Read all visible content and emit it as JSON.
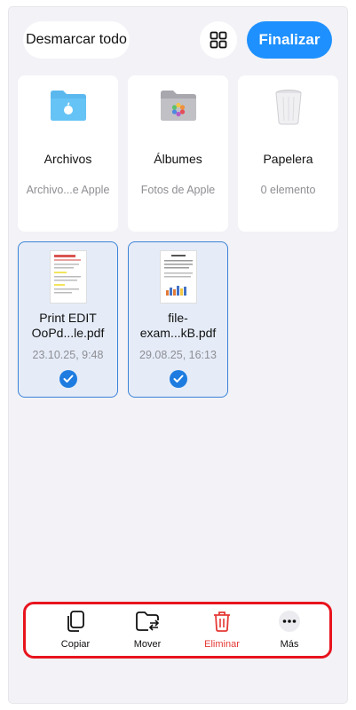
{
  "header": {
    "deselect_label": "Desmarcar todo",
    "finish_label": "Finalizar"
  },
  "locations": [
    {
      "name": "Archivos",
      "sub": "Archivo...e Apple",
      "icon": "folder-icon"
    },
    {
      "name": "Álbumes",
      "sub": "Fotos de Apple",
      "icon": "photos-folder-icon"
    },
    {
      "name": "Papelera",
      "sub": "0 elemento",
      "icon": "trash-can-icon"
    }
  ],
  "files": [
    {
      "name": "Print EDIT OoPd...le.pdf",
      "date": "23.10.25, 9:48",
      "selected": true
    },
    {
      "name": "file-exam...kB.pdf",
      "date": "29.08.25, 16:13",
      "selected": true
    }
  ],
  "toolbar": {
    "copy_label": "Copiar",
    "move_label": "Mover",
    "delete_label": "Eliminar",
    "more_label": "Más"
  },
  "colors": {
    "accent": "#1e90ff",
    "danger": "#e53935",
    "highlight_border": "#e8141e"
  }
}
